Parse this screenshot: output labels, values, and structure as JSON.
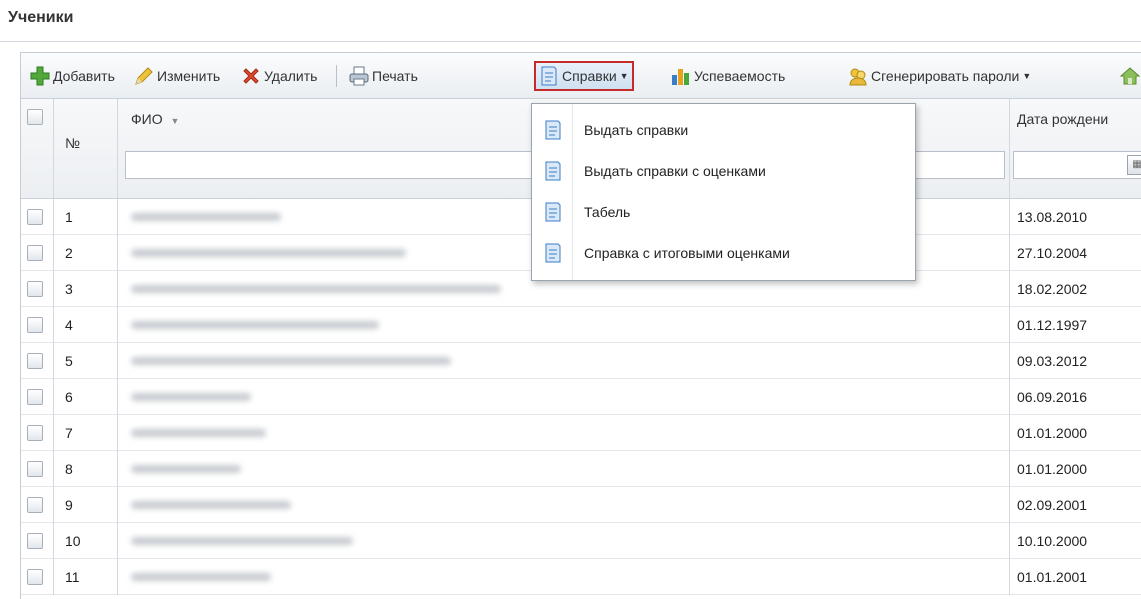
{
  "page": {
    "title": "Ученики"
  },
  "toolbar": {
    "add": "Добавить",
    "edit": "Изменить",
    "delete": "Удалить",
    "print": "Печать",
    "certificates": "Справки",
    "performance": "Успеваемость",
    "generate_passwords": "Сгенерировать пароли"
  },
  "dropdown": {
    "items": [
      {
        "label": "Выдать справки"
      },
      {
        "label": "Выдать справки с оценками"
      },
      {
        "label": "Табель"
      },
      {
        "label": "Справка с итоговыми оценками"
      }
    ]
  },
  "grid": {
    "columns": {
      "num": "№",
      "name": "ФИО",
      "birth": "Дата рождени"
    },
    "rows": [
      {
        "num": "1",
        "birth": "13.08.2010"
      },
      {
        "num": "2",
        "birth": "27.10.2004"
      },
      {
        "num": "3",
        "birth": "18.02.2002"
      },
      {
        "num": "4",
        "birth": "01.12.1997"
      },
      {
        "num": "5",
        "birth": "09.03.2012"
      },
      {
        "num": "6",
        "birth": "06.09.2016"
      },
      {
        "num": "7",
        "birth": "01.01.2000"
      },
      {
        "num": "8",
        "birth": "01.01.2000"
      },
      {
        "num": "9",
        "birth": "02.09.2001"
      },
      {
        "num": "10",
        "birth": "10.10.2000"
      },
      {
        "num": "11",
        "birth": "01.01.2001"
      }
    ]
  },
  "icons": {
    "add": "plus-icon",
    "edit": "pencil-icon",
    "delete": "delete-x-icon",
    "print": "printer-icon",
    "certificates": "document-icon",
    "performance": "bar-chart-icon",
    "generate_passwords": "key-people-icon",
    "home": "home-icon"
  },
  "colors": {
    "active_border": "#c42b2b",
    "accent": "#3a7dc9"
  }
}
